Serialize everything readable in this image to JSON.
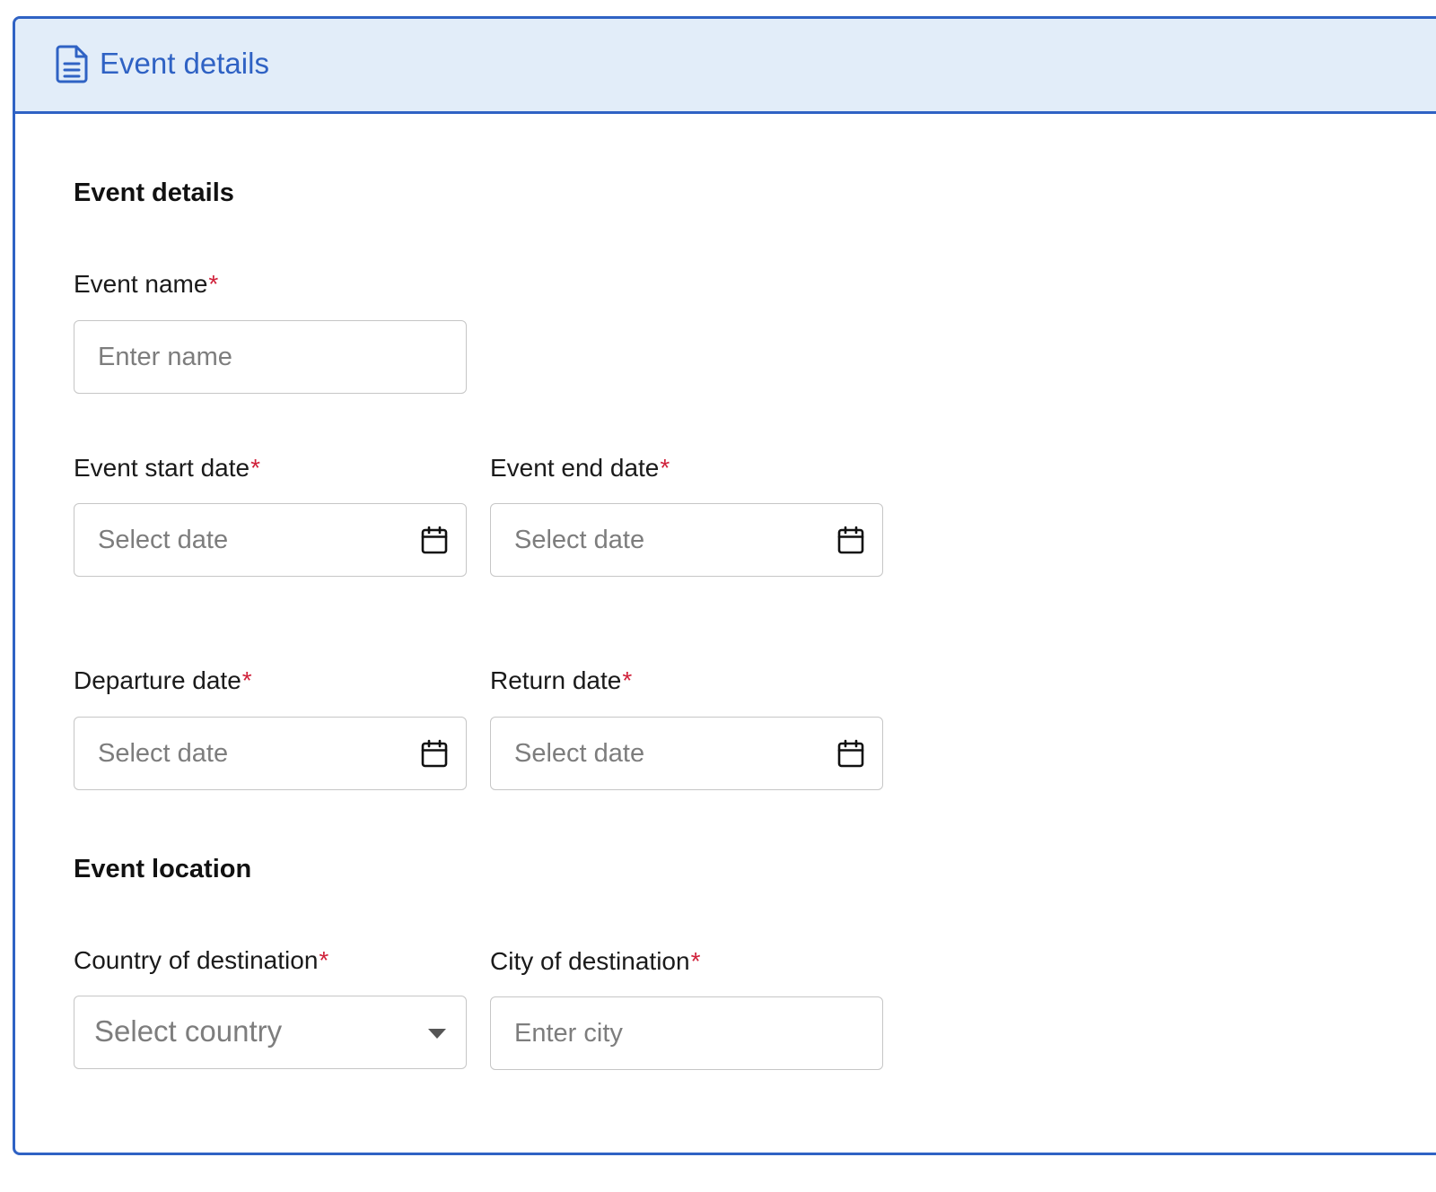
{
  "header": {
    "title": "Event details",
    "icon": "document-icon",
    "accent_color": "#2f62c4",
    "background_color": "#e2edf9"
  },
  "sections": {
    "details_title": "Event details",
    "location_title": "Event location"
  },
  "required_marker": "*",
  "fields": {
    "event_name": {
      "label": "Event name",
      "placeholder": "Enter name"
    },
    "event_start_date": {
      "label": "Event start date",
      "placeholder": "Select date",
      "icon": "calendar-icon"
    },
    "event_end_date": {
      "label": "Event end date",
      "placeholder": "Select date",
      "icon": "calendar-icon"
    },
    "departure_date": {
      "label": "Departure date",
      "placeholder": "Select date",
      "icon": "calendar-icon"
    },
    "return_date": {
      "label": "Return date",
      "placeholder": "Select date",
      "icon": "calendar-icon"
    },
    "country": {
      "label": "Country of destination",
      "placeholder": "Select country",
      "icon": "caret-down-icon"
    },
    "city": {
      "label": "City of destination",
      "placeholder": "Enter city"
    }
  }
}
